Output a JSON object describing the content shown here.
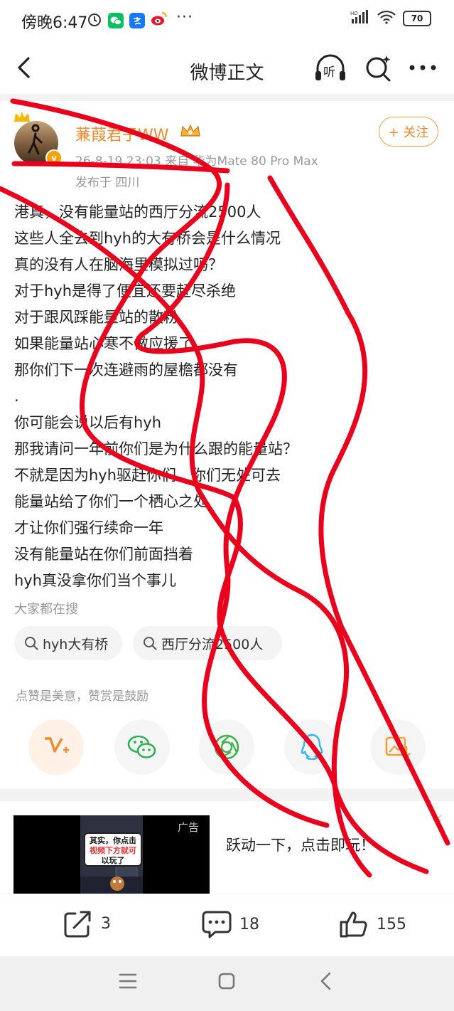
{
  "status_bar": {
    "time": "傍晚6:47",
    "dots": "···",
    "network": "HD",
    "battery": "70"
  },
  "header": {
    "title": "微博正文",
    "listen_label": "听"
  },
  "author": {
    "name": "蒹葭君子WW",
    "meta": "26-8-19 23:03  来自 华为Mate 80 Pro Max",
    "location": "发布于 四川",
    "follow_label": "+ 关注"
  },
  "post": {
    "lines": [
      "港真，没有能量站的西厅分流2500人",
      "这些人全去到hyh的大有桥会是什么情况",
      "真的没有人在脑海里模拟过吗？",
      "对于hyh是得了便宜还要赶尽杀绝",
      "对于跟风踩能量站的散粉",
      "如果能量站心寒不做应援了",
      "那你们下一次连避雨的屋檐都没有",
      ".",
      "你可能会说以后有hyh",
      "那我请问一年前你们是为什么跟的能量站？",
      "不就是因为hyh驱赶你们，你们无处可去",
      "能量站给了你们一个栖心之处",
      "才让你们强行续命一年",
      "没有能量站在你们前面挡着",
      "hyh真没拿你们当个事儿"
    ]
  },
  "search": {
    "label": "大家都在搜",
    "chips": [
      "hyh大有桥",
      "西厅分流2500人"
    ]
  },
  "reward": {
    "text": "点赞是美意，赞赏是鼓励"
  },
  "ad": {
    "tag": "广告",
    "bubble_line1": "其实，你点击",
    "bubble_line2": "视频下方就可",
    "bubble_line3": "以玩了",
    "text": "跃动一下，点击即玩！",
    "close": "×"
  },
  "actions": {
    "repost_count": "3",
    "comment_count": "18",
    "like_count": "155"
  },
  "colors": {
    "accent": "#f08a2c",
    "scribble": "#e8001c"
  }
}
